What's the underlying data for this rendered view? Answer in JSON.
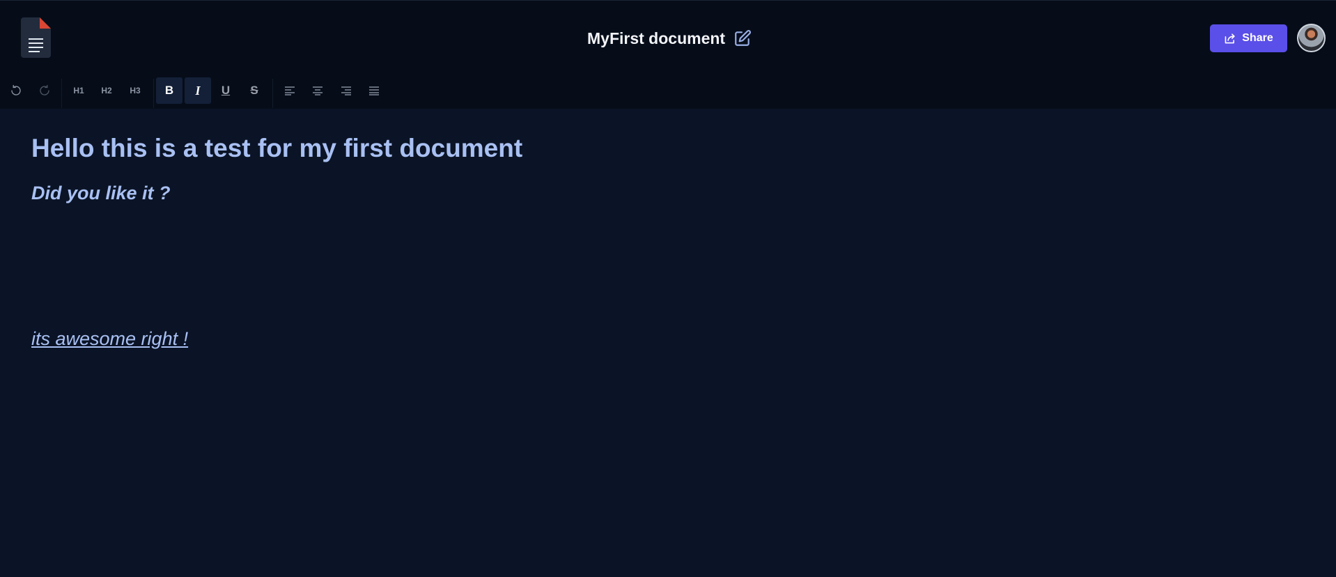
{
  "header": {
    "doc_title": "MyFirst document",
    "share_label": "Share",
    "share_button_color": "#5a4fe8",
    "logo_icon": "document-icon",
    "edit_icon": "edit-icon",
    "avatar": "user-avatar"
  },
  "toolbar": {
    "undo_icon": "undo-icon",
    "redo_icon": "redo-icon",
    "h1_label": "H1",
    "h2_label": "H2",
    "h3_label": "H3",
    "bold_label": "B",
    "italic_label": "I",
    "underline_label": "U",
    "strike_label": "S",
    "align_icons": [
      "align-left-icon",
      "align-center-icon",
      "align-right-icon",
      "align-justify-icon"
    ],
    "active": [
      "bold",
      "italic"
    ]
  },
  "editor": {
    "heading1": "Hello this is a test for my first document",
    "heading2": "Did you like it ?",
    "paragraph": "its awesome right !"
  },
  "colors": {
    "background": "#0b1426",
    "topbar": "#060d19",
    "text": "#a9c0f3"
  }
}
